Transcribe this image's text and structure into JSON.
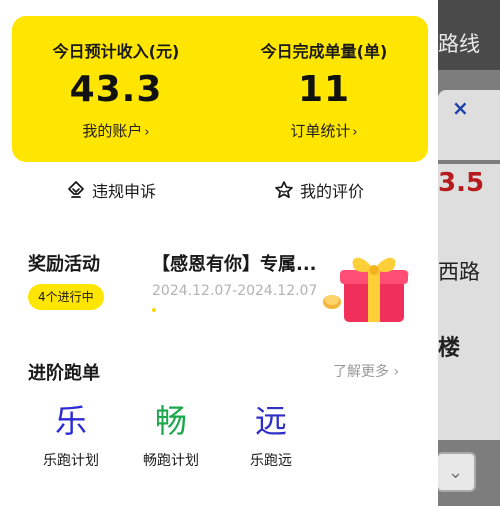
{
  "background": {
    "route_text": "路线",
    "close_glyph": "×",
    "price_text": "3.5",
    "road_text": "西路",
    "building_text": "楼",
    "chevron_glyph": "⌄"
  },
  "stats": {
    "income_label": "今日预计收入(元)",
    "income_value": "43.3",
    "income_link": "我的账户",
    "orders_label": "今日完成单量(单)",
    "orders_value": "11",
    "orders_link": "订单统计",
    "chevron": "›"
  },
  "actions": {
    "violation_appeal": "违规申诉",
    "my_rating": "我的评价"
  },
  "reward": {
    "section_title": "奖励活动",
    "active_badge": "4个进行中",
    "activity_name": "【感恩有你】专属...",
    "activity_date": "2024.12.07-2024.12.07"
  },
  "advanced": {
    "section_title": "进阶跑单",
    "more_link": "了解更多 ›",
    "items": [
      {
        "glyph": "乐",
        "label": "乐跑计划",
        "color": "#2b2bd6"
      },
      {
        "glyph": "畅",
        "label": "畅跑计划",
        "color": "#1aa84a"
      },
      {
        "glyph": "远",
        "label": "乐跑远",
        "color": "#3030c8"
      }
    ]
  },
  "colors": {
    "accent_yellow": "#ffe600",
    "overlay_gray": "#7d7d7d"
  }
}
